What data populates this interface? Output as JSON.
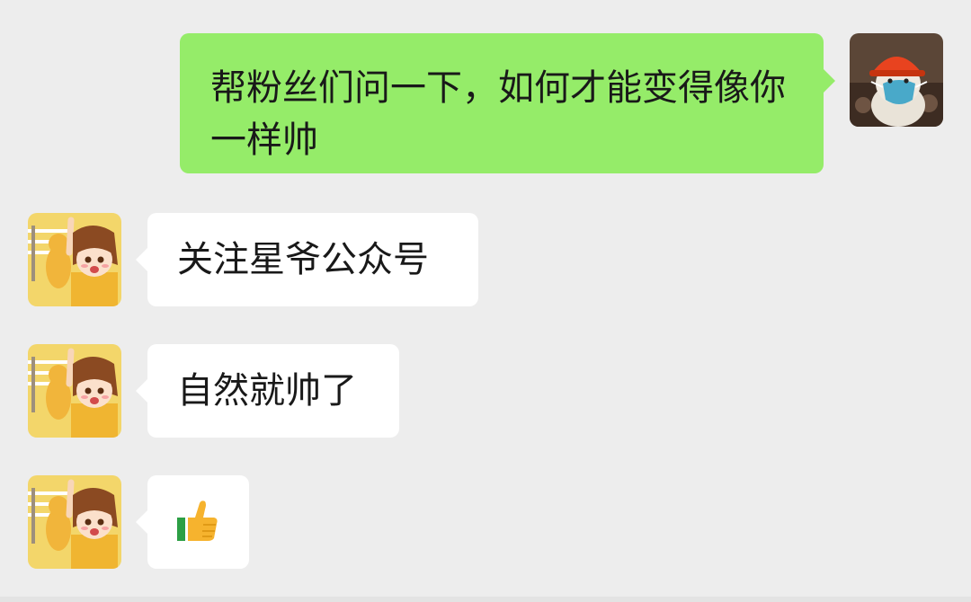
{
  "chat": {
    "messages": [
      {
        "side": "outgoing",
        "type": "text",
        "text": "帮粉丝们问一下，如何才能变得像你一样帅"
      },
      {
        "side": "incoming",
        "type": "text",
        "text": "关注星爷公众号"
      },
      {
        "side": "incoming",
        "type": "text",
        "text": "自然就帅了"
      },
      {
        "side": "incoming",
        "type": "emoji",
        "emoji": "thumbs-up"
      }
    ]
  },
  "colors": {
    "background": "#ededed",
    "outgoing_bubble": "#95ec69",
    "incoming_bubble": "#ffffff",
    "text": "#191919"
  }
}
